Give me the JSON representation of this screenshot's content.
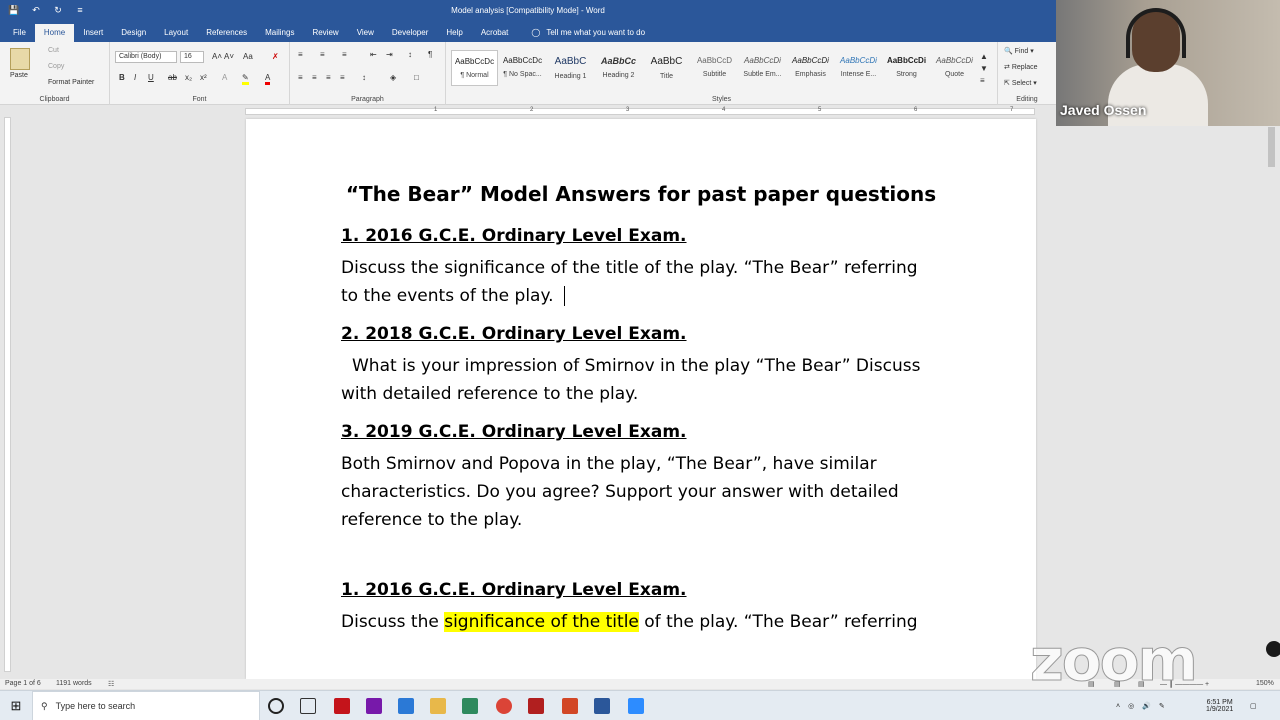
{
  "window": {
    "title": "Model analysis [Compatibility Mode]  -  Word"
  },
  "quick_access": [
    "save-icon",
    "undo-icon",
    "redo-icon",
    "customize-icon"
  ],
  "ribbon_tabs": [
    "File",
    "Home",
    "Insert",
    "Design",
    "Layout",
    "References",
    "Mailings",
    "Review",
    "View",
    "Developer",
    "Help",
    "Acrobat"
  ],
  "active_tab": "Home",
  "tell_me": "Tell me what you want to do",
  "clipboard": {
    "paste": "Paste",
    "cut": "Cut",
    "copy": "Copy",
    "format_painter": "Format Painter",
    "label": "Clipboard"
  },
  "font": {
    "name": "Calibri (Body)",
    "size": "16",
    "label": "Font"
  },
  "paragraph": {
    "label": "Paragraph"
  },
  "styles": {
    "label": "Styles",
    "items": [
      {
        "preview": "AaBbCcDc",
        "name": "¶ Normal"
      },
      {
        "preview": "AaBbCcDc",
        "name": "¶ No Spac..."
      },
      {
        "preview": "AaBbC",
        "name": "Heading 1"
      },
      {
        "preview": "AaBbCc",
        "name": "Heading 2"
      },
      {
        "preview": "AaBbC",
        "name": "Title"
      },
      {
        "preview": "AaBbCcD",
        "name": "Subtitle"
      },
      {
        "preview": "AaBbCcDi",
        "name": "Subtle Em..."
      },
      {
        "preview": "AaBbCcDi",
        "name": "Emphasis"
      },
      {
        "preview": "AaBbCcDi",
        "name": "Intense E..."
      },
      {
        "preview": "AaBbCcDi",
        "name": "Strong"
      },
      {
        "preview": "AaBbCcDi",
        "name": "Quote"
      }
    ]
  },
  "editing": {
    "find": "Find",
    "replace": "Replace",
    "select": "Select",
    "label": "Editing"
  },
  "ruler_numbers": [
    "1",
    "2",
    "3",
    "4",
    "5",
    "6",
    "7"
  ],
  "document": {
    "title": "“The Bear” Model Answers for past paper questions",
    "sections": [
      {
        "heading": "1. 2016 G.C.E. Ordinary Level Exam.",
        "text": "Discuss the significance of the title of the play. “The Bear” referring to the events of the play."
      },
      {
        "heading": "2. 2018 G.C.E. Ordinary Level Exam.",
        "text": "What is your impression of Smirnov in the play “The Bear” Discuss with detailed reference to the play."
      },
      {
        "heading": "3. 2019 G.C.E. Ordinary Level Exam.",
        "text": "Both Smirnov and Popova in the play, “The Bear”, have similar characteristics. Do you agree? Support your answer with detailed reference to the play."
      },
      {
        "heading": "1. 2016 G.C.E. Ordinary Level Exam.",
        "text_before": "Discuss the ",
        "highlight": "significance of the title",
        "text_after": " of the play. “The Bear” referring"
      }
    ]
  },
  "status_bar": {
    "page": "Page 1 of 6",
    "words": "1191 words",
    "zoom": "150%"
  },
  "participant": {
    "name": "Javed Ossen"
  },
  "watermark": "zoom",
  "taskbar": {
    "search_placeholder": "Type here to search",
    "time": "6:51 PM",
    "date": "1/9/2021"
  },
  "colors": {
    "word_blue": "#2b579a",
    "highlight": "#ffff00"
  }
}
